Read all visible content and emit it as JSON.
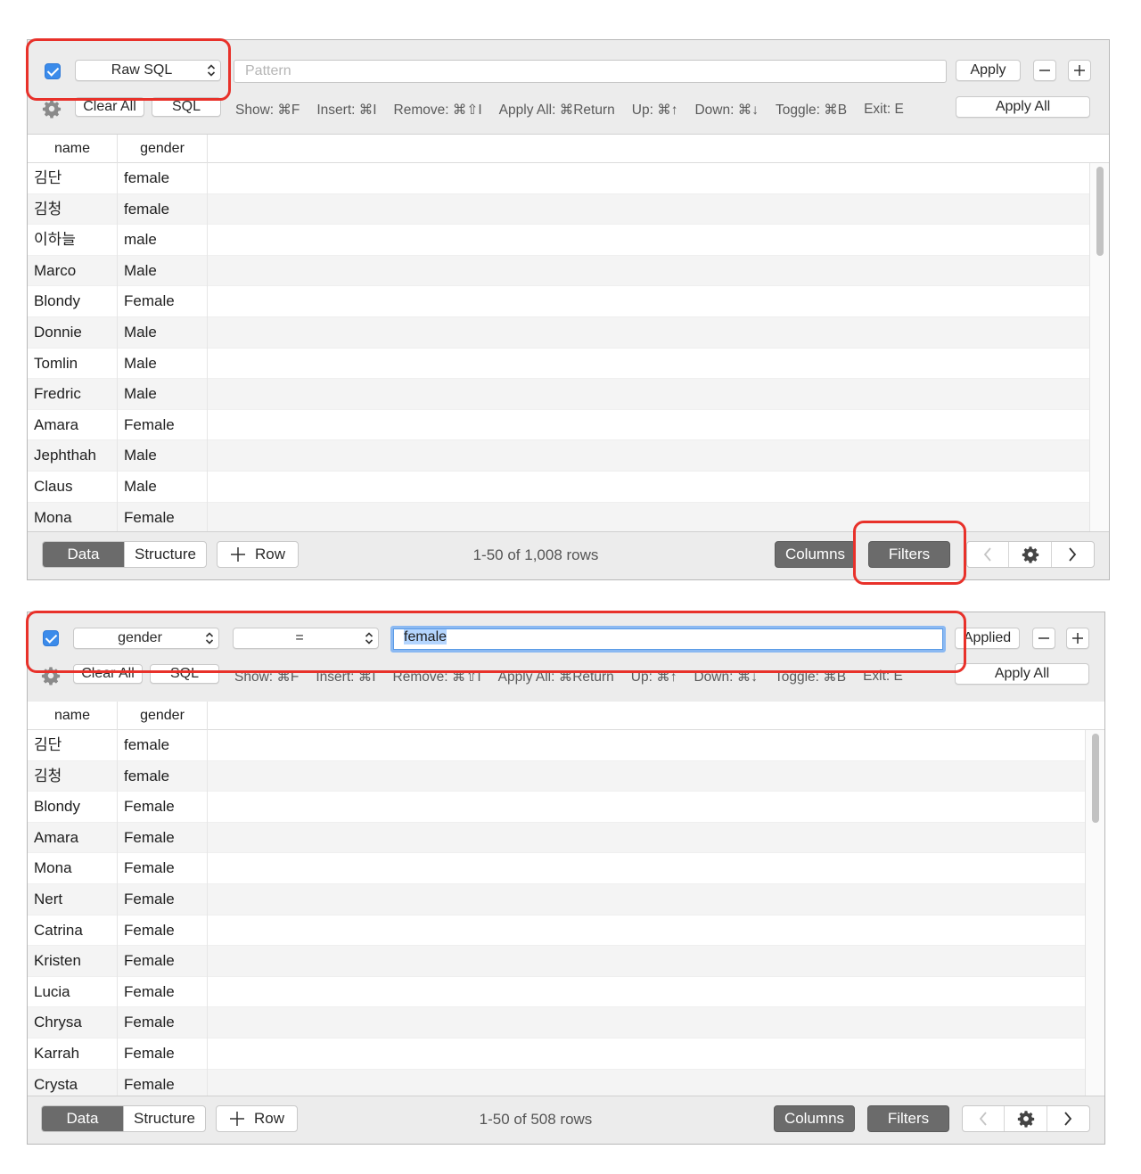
{
  "colors": {
    "accent_blue": "#3b8bea",
    "highlight_red": "#e8312a",
    "selected_segment": "#6b6b6b"
  },
  "panel1": {
    "filter_enabled": true,
    "column_select": "Raw SQL",
    "pattern_placeholder": "Pattern",
    "apply_label": "Apply",
    "minus_label": "—",
    "plus_label": "+",
    "clear_all_label": "Clear All",
    "sql_label": "SQL",
    "hints": [
      "Show: ⌘F",
      "Insert: ⌘I",
      "Remove: ⌘⇧I",
      "Apply All: ⌘Return",
      "Up: ⌘↑",
      "Down: ⌘↓",
      "Toggle: ⌘B",
      "Exit: E"
    ],
    "apply_all_label": "Apply All",
    "columns": [
      "name",
      "gender"
    ],
    "rows": [
      [
        "김단",
        "female"
      ],
      [
        "김청",
        "female"
      ],
      [
        "이하늘",
        "male"
      ],
      [
        "Marco",
        "Male"
      ],
      [
        "Blondy",
        "Female"
      ],
      [
        "Donnie",
        "Male"
      ],
      [
        "Tomlin",
        "Male"
      ],
      [
        "Fredric",
        "Male"
      ],
      [
        "Amara",
        "Female"
      ],
      [
        "Jephthah",
        "Male"
      ],
      [
        "Claus",
        "Male"
      ],
      [
        "Mona",
        "Female"
      ]
    ],
    "footer": {
      "tab_data": "Data",
      "tab_structure": "Structure",
      "add_row": "Row",
      "status": "1-50 of 1,008 rows",
      "columns_label": "Columns",
      "filters_label": "Filters"
    }
  },
  "panel2": {
    "filter_enabled": true,
    "column_select": "gender",
    "operator_select": "=",
    "value": "female",
    "applied_label": "Applied",
    "minus_label": "—",
    "plus_label": "+",
    "clear_all_label": "Clear All",
    "sql_label": "SQL",
    "hints": [
      "Show: ⌘F",
      "Insert: ⌘I",
      "Remove: ⌘⇧I",
      "Apply All: ⌘Return",
      "Up: ⌘↑",
      "Down: ⌘↓",
      "Toggle: ⌘B",
      "Exit: E"
    ],
    "apply_all_label": "Apply All",
    "columns": [
      "name",
      "gender"
    ],
    "rows": [
      [
        "김단",
        "female"
      ],
      [
        "김청",
        "female"
      ],
      [
        "Blondy",
        "Female"
      ],
      [
        "Amara",
        "Female"
      ],
      [
        "Mona",
        "Female"
      ],
      [
        "Nert",
        "Female"
      ],
      [
        "Catrina",
        "Female"
      ],
      [
        "Kristen",
        "Female"
      ],
      [
        "Lucia",
        "Female"
      ],
      [
        "Chrysa",
        "Female"
      ],
      [
        "Karrah",
        "Female"
      ],
      [
        "Crysta",
        "Female"
      ]
    ],
    "footer": {
      "tab_data": "Data",
      "tab_structure": "Structure",
      "add_row": "Row",
      "status": "1-50 of 508 rows",
      "columns_label": "Columns",
      "filters_label": "Filters"
    }
  }
}
